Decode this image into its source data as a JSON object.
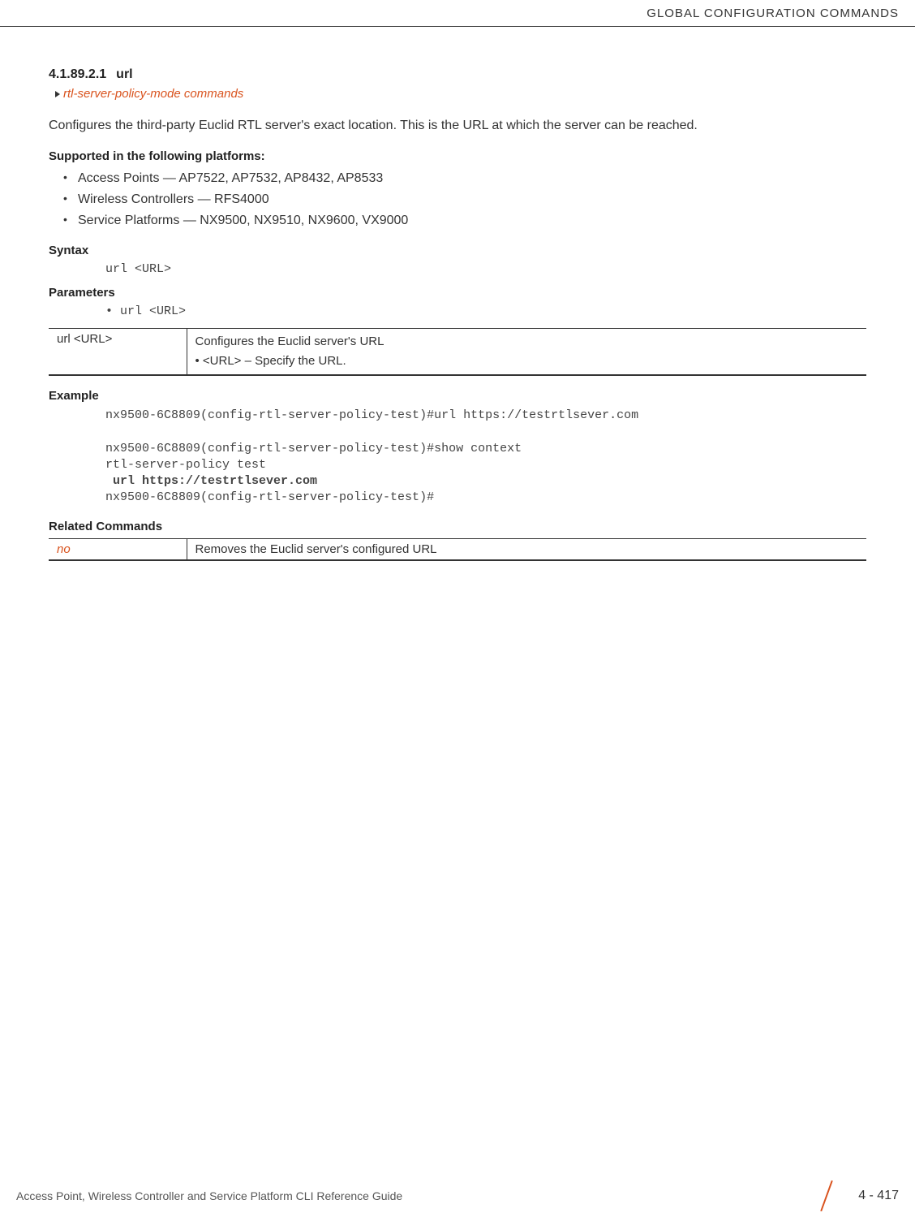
{
  "header": {
    "title": "GLOBAL CONFIGURATION COMMANDS"
  },
  "section": {
    "number": "4.1.89.2.1",
    "title": "url",
    "breadcrumb": "rtl-server-policy-mode commands",
    "description": "Configures the third-party Euclid RTL server's exact location. This is the URL at which the server can be reached."
  },
  "supported": {
    "heading": "Supported in the following platforms:",
    "items": [
      "Access Points — AP7522, AP7532, AP8432, AP8533",
      "Wireless Controllers — RFS4000",
      "Service Platforms — NX9500, NX9510, NX9600, VX9000"
    ]
  },
  "syntax": {
    "heading": "Syntax",
    "code": "url <URL>"
  },
  "parameters": {
    "heading": "Parameters",
    "line": "• url <URL>",
    "table": {
      "col1": "url <URL>",
      "col2_line1": "Configures the Euclid server's URL",
      "col2_line2": "• <URL> – Specify the URL."
    }
  },
  "example": {
    "heading": "Example",
    "line1": "nx9500-6C8809(config-rtl-server-policy-test)#url https://testrtlsever.com",
    "line2": "nx9500-6C8809(config-rtl-server-policy-test)#show context",
    "line3": "rtl-server-policy test",
    "line4": " url https://testrtlsever.com",
    "line5": "nx9500-6C8809(config-rtl-server-policy-test)#"
  },
  "related": {
    "heading": "Related Commands",
    "table": {
      "col1": "no",
      "col2": "Removes the Euclid server's configured URL"
    }
  },
  "footer": {
    "text": "Access Point, Wireless Controller and Service Platform CLI Reference Guide",
    "page": "4 - 417"
  }
}
